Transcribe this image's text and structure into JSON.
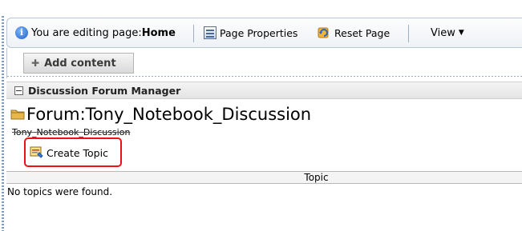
{
  "toolbar": {
    "editing_prefix": "You are editing page: ",
    "editing_page": "Home",
    "page_properties": "Page Properties",
    "reset_page": "Reset Page",
    "view": "View",
    "icons": {
      "info": "info-icon",
      "page_properties": "page-properties-icon",
      "reset": "reset-icon",
      "dropdown": "chevron-down-icon"
    }
  },
  "add_content": {
    "label": "Add content",
    "icon": "plus-icon"
  },
  "portlet": {
    "title": "Discussion Forum Manager"
  },
  "forum": {
    "title": "Forum:Tony_Notebook_Discussion",
    "subtitle": "Tony_Notebook_Discussion",
    "create_topic": "Create Topic"
  },
  "table": {
    "columns": [
      "Topic"
    ],
    "empty_message": "No topics were found."
  },
  "colors": {
    "highlight": "#e11111",
    "toolbar_border": "#b7c5d6"
  }
}
